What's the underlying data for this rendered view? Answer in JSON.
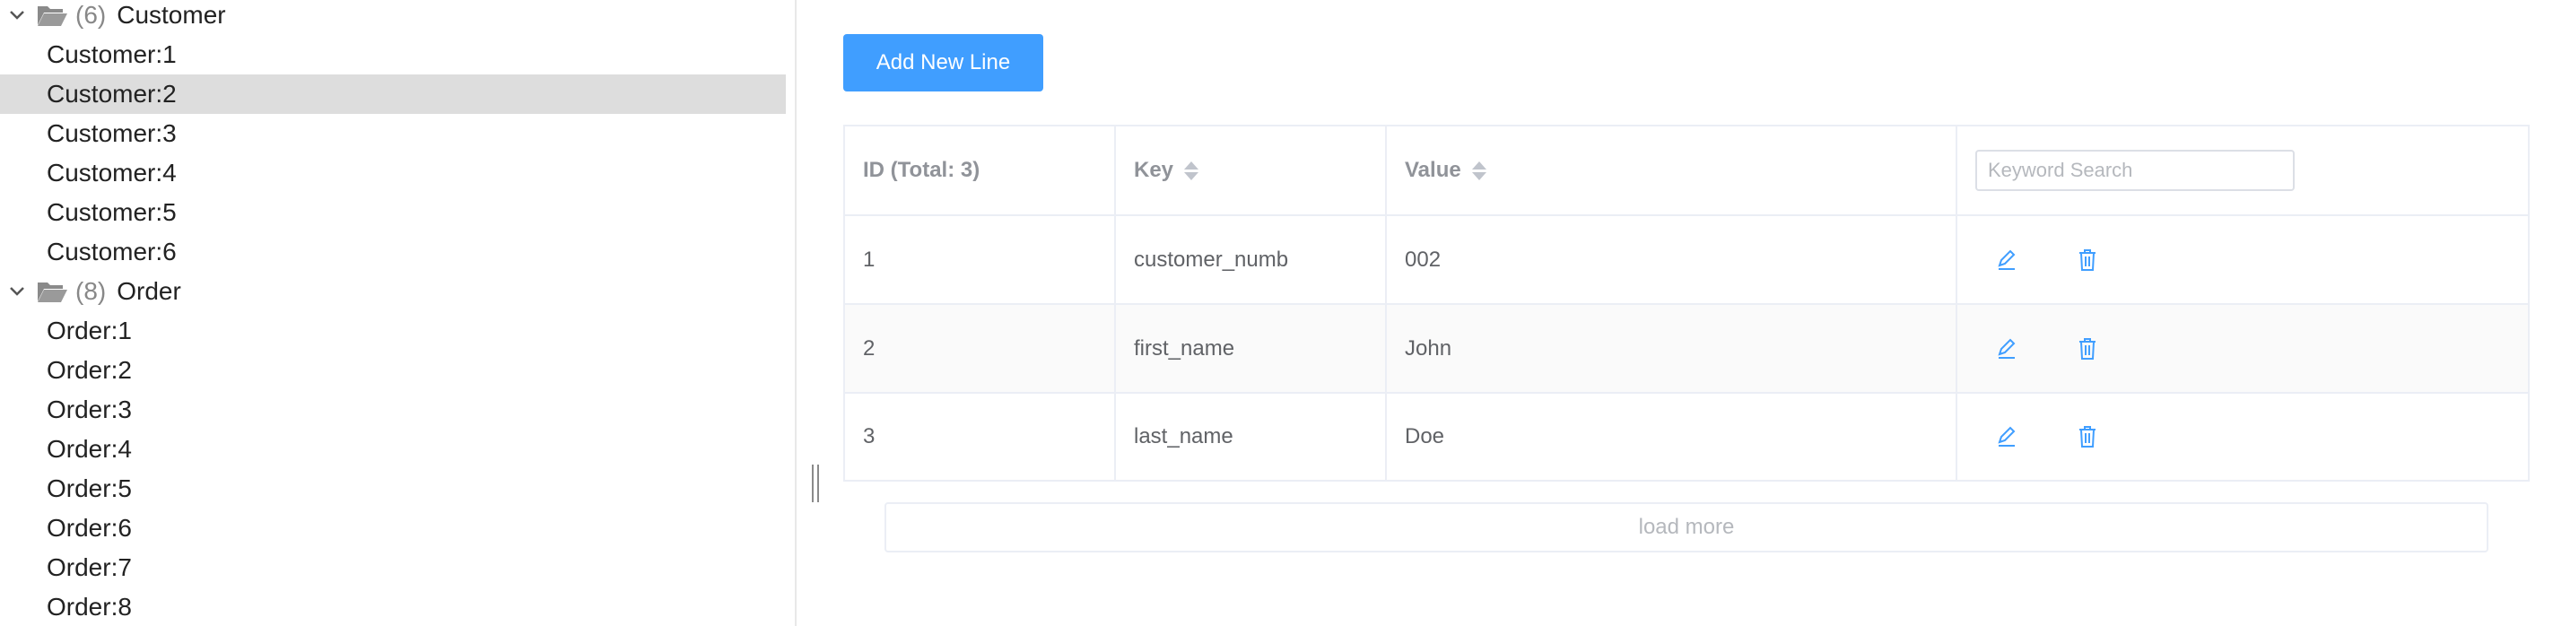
{
  "tree": {
    "groups": [
      {
        "count": "(6)",
        "name": "Customer",
        "items": [
          "Customer:1",
          "Customer:2",
          "Customer:3",
          "Customer:4",
          "Customer:5",
          "Customer:6"
        ]
      },
      {
        "count": "(8)",
        "name": "Order",
        "items": [
          "Order:1",
          "Order:2",
          "Order:3",
          "Order:4",
          "Order:5",
          "Order:6",
          "Order:7",
          "Order:8"
        ]
      }
    ],
    "selected": "Customer:2"
  },
  "toolbar": {
    "add_label": "Add New Line"
  },
  "table": {
    "headers": {
      "id": "ID (Total: 3)",
      "key": "Key",
      "value": "Value"
    },
    "search_placeholder": "Keyword Search",
    "rows": [
      {
        "id": "1",
        "key": "customer_numb",
        "value": "002"
      },
      {
        "id": "2",
        "key": "first_name",
        "value": "John"
      },
      {
        "id": "3",
        "key": "last_name",
        "value": "Doe"
      }
    ]
  },
  "footer": {
    "load_more_label": "load more"
  },
  "colors": {
    "accent": "#409eff",
    "selected_row": "#dddddd",
    "border": "#ebeef5"
  },
  "icons": {
    "folder": "folder-open-icon",
    "chevron": "chevron-down-icon",
    "edit": "edit-icon",
    "delete": "trash-icon"
  }
}
